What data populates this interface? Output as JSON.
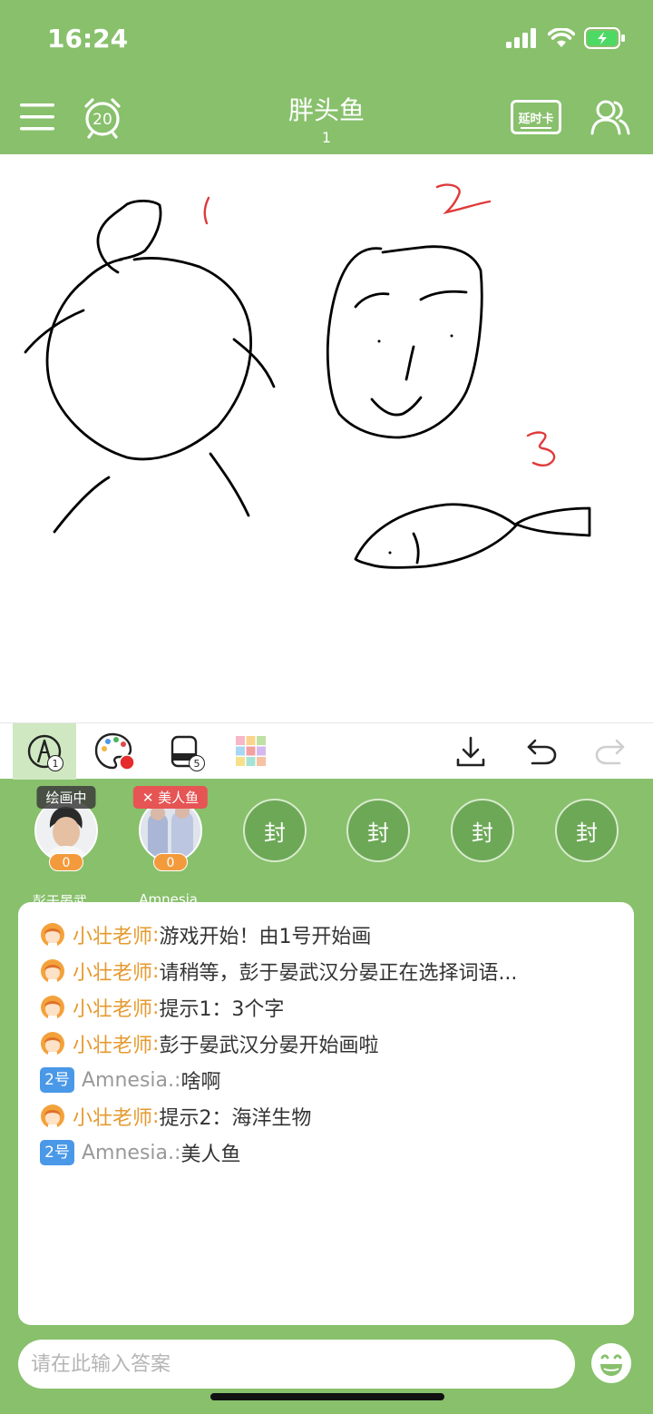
{
  "status_bar": {
    "time": "16:24",
    "battery_state": "charging"
  },
  "header": {
    "title": "胖头鱼",
    "subtitle": "1",
    "timer_value": "20",
    "extend_card_label": "延时卡",
    "icons": [
      "menu-icon",
      "alarm-clock-icon",
      "extend-time-card-icon",
      "players-icon"
    ]
  },
  "canvas": {
    "annotations": [
      "1",
      "2",
      "3"
    ],
    "stroke_color": "#000000",
    "annotation_color": "#e03a3a"
  },
  "toolbar": {
    "brush_size": "1",
    "eraser_size": "5",
    "palette_selected_color": "#e52b2b",
    "icons": [
      "brush-icon",
      "palette-icon",
      "eraser-icon",
      "grid-color-icon",
      "download-icon",
      "undo-icon",
      "redo-icon"
    ]
  },
  "players": [
    {
      "name": "彭于晏武...",
      "score": "0",
      "tag": "绘画中"
    },
    {
      "name": "Amnesia.",
      "score": "0",
      "tag": "美人鱼"
    }
  ],
  "sealed_slots": [
    "封",
    "封",
    "封",
    "封"
  ],
  "chat": [
    {
      "sender": "小壮老师",
      "sep": ":",
      "text": "游戏开始！由1号开始画",
      "type": "teacher"
    },
    {
      "sender": "小壮老师",
      "sep": ":",
      "text": "请稍等，彭于晏武汉分晏正在选择词语...",
      "type": "teacher"
    },
    {
      "sender": "小壮老师",
      "sep": ":",
      "text": "提示1：3个字",
      "type": "teacher"
    },
    {
      "sender": "小壮老师",
      "sep": ":",
      "text": "彭于晏武汉分晏开始画啦",
      "type": "teacher"
    },
    {
      "badge": "2号",
      "sender": "Amnesia.",
      "sep": ":",
      "text": "啥啊",
      "type": "player"
    },
    {
      "sender": "小壮老师",
      "sep": ":",
      "text": "提示2：海洋生物",
      "type": "teacher"
    },
    {
      "badge": "2号",
      "sender": "Amnesia.",
      "sep": ":",
      "text": "美人鱼",
      "type": "player"
    }
  ],
  "input": {
    "placeholder": "请在此输入答案",
    "value": ""
  },
  "colors": {
    "theme_green": "#88c06c",
    "teacher_orange": "#e59a2f",
    "badge_blue": "#4a98e8",
    "tag_red": "#e65454",
    "score_orange": "#f39b3c"
  }
}
